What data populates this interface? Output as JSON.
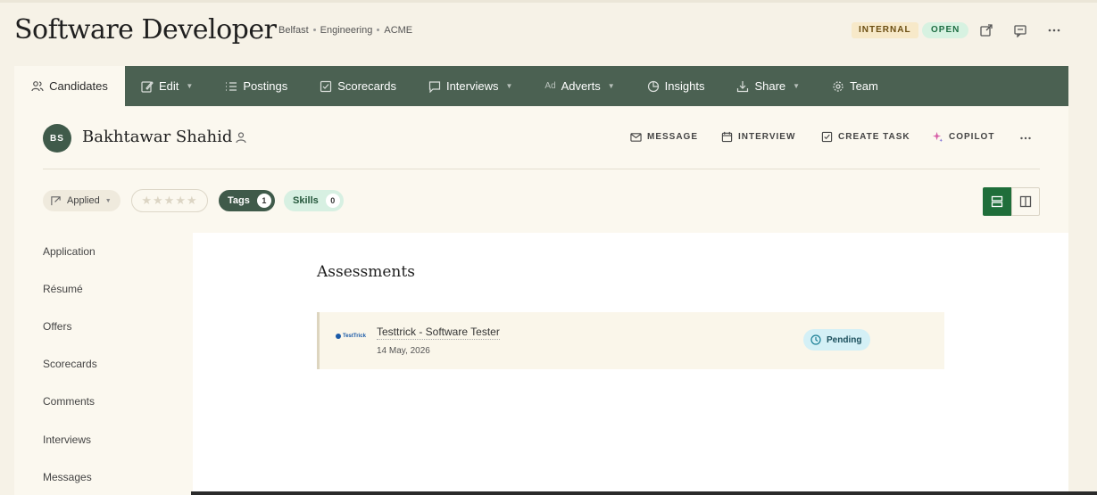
{
  "header": {
    "title": "Software Developer",
    "meta": [
      "Belfast",
      "Engineering",
      "ACME"
    ],
    "badge_internal": "INTERNAL",
    "badge_open": "OPEN"
  },
  "nav": {
    "items": [
      {
        "label": "Candidates",
        "icon": "users-icon"
      },
      {
        "label": "Edit",
        "icon": "edit-icon"
      },
      {
        "label": "Postings",
        "icon": "list-icon"
      },
      {
        "label": "Scorecards",
        "icon": "checkbox-icon"
      },
      {
        "label": "Interviews",
        "icon": "chat-icon"
      },
      {
        "label": "Adverts",
        "icon": "ad-icon",
        "prefix": "Ad"
      },
      {
        "label": "Insights",
        "icon": "pie-icon"
      },
      {
        "label": "Share",
        "icon": "download-icon"
      },
      {
        "label": "Team",
        "icon": "gear-icon"
      }
    ]
  },
  "candidate": {
    "initials": "BS",
    "name": "Bakhtawar Shahid",
    "actions": {
      "message": "MESSAGE",
      "interview": "INTERVIEW",
      "create_task": "CREATE TASK",
      "copilot": "COPILOT"
    }
  },
  "filters": {
    "status": "Applied",
    "rating_stars": "★★★★★",
    "tags_label": "Tags",
    "tags_count": "1",
    "skills_label": "Skills",
    "skills_count": "0"
  },
  "side_menu": [
    "Application",
    "Résumé",
    "Offers",
    "Scorecards",
    "Comments",
    "Interviews",
    "Messages"
  ],
  "content": {
    "title": "Assessments",
    "assessment": {
      "logo_text": "TestTrick",
      "name": "Testtrick - Software Tester",
      "date": "14 May, 2026",
      "status": "Pending"
    }
  },
  "colors": {
    "nav_bg": "#4b6152",
    "accent_green": "#1f6e3a",
    "pending_bg": "#d4f0f6"
  }
}
